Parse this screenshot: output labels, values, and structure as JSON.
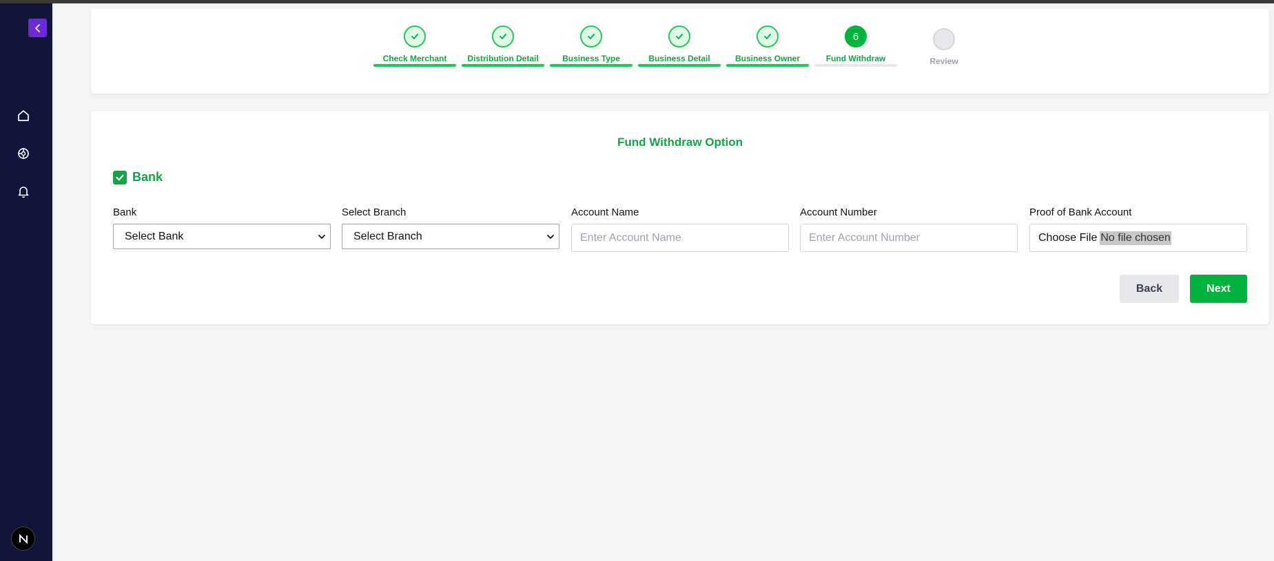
{
  "stepper": {
    "steps": [
      {
        "label": "Check Merchant",
        "status": "done"
      },
      {
        "label": "Distribution Detail",
        "status": "done"
      },
      {
        "label": "Business Type",
        "status": "done"
      },
      {
        "label": "Business Detail",
        "status": "done"
      },
      {
        "label": "Business Owner",
        "status": "done"
      },
      {
        "label": "Fund Withdraw",
        "status": "active",
        "number": "6"
      },
      {
        "label": "Review",
        "status": "pending"
      }
    ]
  },
  "form": {
    "title": "Fund Withdraw Option",
    "bank_checkbox_label": "Bank",
    "bank_checked": true,
    "fields": {
      "bank": {
        "label": "Bank",
        "selected": "Select Bank"
      },
      "branch": {
        "label": "Select Branch",
        "selected": "Select Branch"
      },
      "account_name": {
        "label": "Account Name",
        "placeholder": "Enter Account Name"
      },
      "account_number": {
        "label": "Account Number",
        "placeholder": "Enter Account Number"
      },
      "proof": {
        "label": "Proof of Bank Account",
        "button": "Choose File",
        "status": "No file chosen"
      }
    },
    "back_label": "Back",
    "next_label": "Next"
  },
  "sidebar": {
    "icons": [
      "chevron-left-icon",
      "home-icon",
      "compass-icon",
      "bell-icon"
    ],
    "avatar_letter": "N"
  },
  "colors": {
    "accent_green": "#16a34a",
    "primary_button": "#00b33c",
    "sidebar_bg": "#12153a",
    "collapse_button": "#6d28d9"
  }
}
